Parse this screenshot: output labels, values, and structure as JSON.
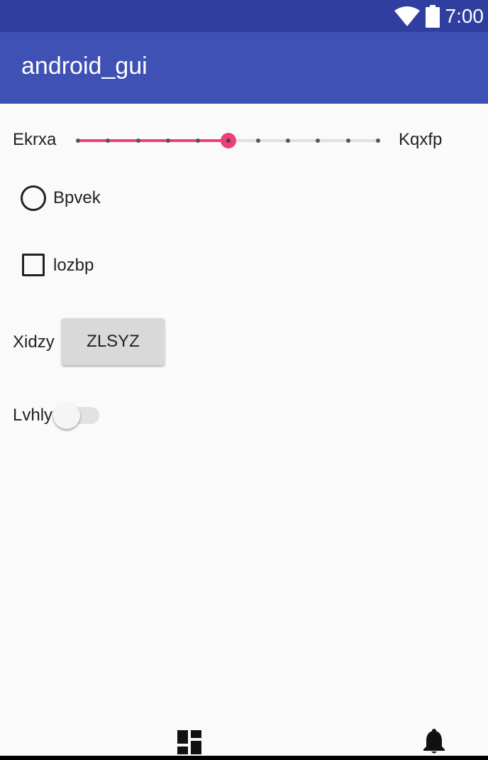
{
  "status_bar": {
    "time": "7:00",
    "icons": [
      "wifi-icon",
      "battery-icon"
    ]
  },
  "app_bar": {
    "title": "android_gui"
  },
  "slider": {
    "min_label": "Ekrxa",
    "max_label": "Kqxfp",
    "steps": 10,
    "value": 5
  },
  "radio": {
    "label": "Bpvek",
    "checked": false
  },
  "checkbox": {
    "label": "lozbp",
    "checked": false
  },
  "button_row": {
    "label": "Xidzy",
    "button_text": "ZLSYZ"
  },
  "switch": {
    "label": "Lvhly",
    "on": false
  },
  "bottom_nav": {
    "icons": [
      "dashboard-icon",
      "notifications-icon"
    ]
  },
  "colors": {
    "status_bar": "#303f9f",
    "app_bar": "#3f51b5",
    "accent": "#ec407a",
    "background": "#fafafa"
  }
}
